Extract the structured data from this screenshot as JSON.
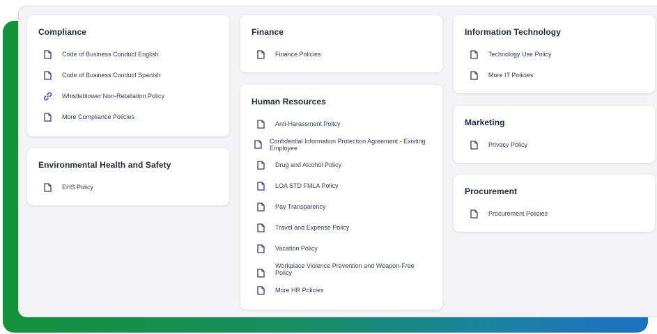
{
  "columns": [
    {
      "cards": [
        {
          "title": "Compliance",
          "items": [
            {
              "label": "Code of Business Conduct English",
              "icon": "document-icon"
            },
            {
              "label": "Code of Business Conduct Spanish",
              "icon": "document-icon"
            },
            {
              "label": "Whistleblower Non-Retaliation Policy",
              "icon": "link-icon"
            },
            {
              "label": "More Compliance Policies",
              "icon": "document-icon"
            }
          ]
        },
        {
          "title": "Environmental Health and Safety",
          "items": [
            {
              "label": "EHS Policy",
              "icon": "document-icon"
            }
          ]
        }
      ]
    },
    {
      "cards": [
        {
          "title": "Finance",
          "items": [
            {
              "label": "Finance Policies",
              "icon": "document-icon"
            }
          ]
        },
        {
          "title": "Human Resources",
          "items": [
            {
              "label": "Anti-Harassment Policy",
              "icon": "document-icon"
            },
            {
              "label": "Confidential Information Protection Agreement - Existing Employee",
              "icon": "document-icon"
            },
            {
              "label": "Drug and Alcohol Policy",
              "icon": "document-icon"
            },
            {
              "label": "LOA STD FMLA Policy",
              "icon": "document-icon"
            },
            {
              "label": "Pay Transparency",
              "icon": "document-icon"
            },
            {
              "label": "Travel and Expense Policy",
              "icon": "document-icon"
            },
            {
              "label": "Vacation Policy",
              "icon": "document-icon"
            },
            {
              "label": "Workplace Violence Prevention and Weapon-Free Policy",
              "icon": "document-icon"
            },
            {
              "label": "More HR Policies",
              "icon": "document-icon"
            }
          ]
        }
      ]
    },
    {
      "cards": [
        {
          "title": "Information Technology",
          "items": [
            {
              "label": "Technology Use Policy",
              "icon": "document-icon"
            },
            {
              "label": "More IT Policies",
              "icon": "document-icon"
            }
          ]
        },
        {
          "title": "Marketing",
          "items": [
            {
              "label": "Privacy Policy",
              "icon": "document-icon"
            }
          ]
        },
        {
          "title": "Procurement",
          "items": [
            {
              "label": "Procurement Policies",
              "icon": "document-icon"
            }
          ]
        }
      ]
    }
  ],
  "colors": {
    "gradient_start": "#14913a",
    "gradient_end": "#1d70c4",
    "icon": "#3b3a6b",
    "link_icon": "#4a4aa8"
  }
}
